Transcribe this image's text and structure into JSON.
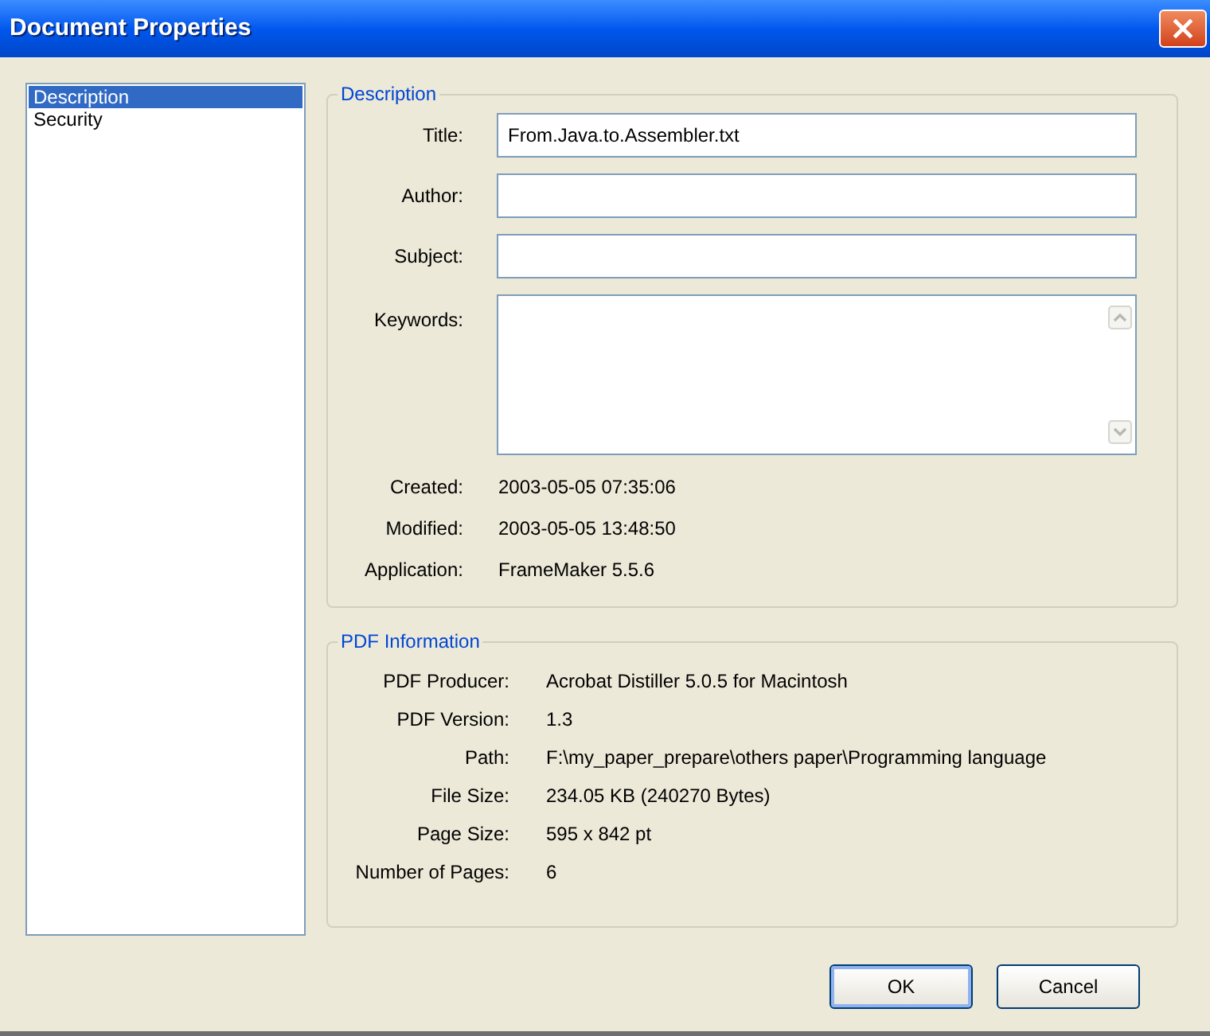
{
  "window": {
    "title": "Document Properties"
  },
  "sidebar": {
    "items": [
      {
        "label": "Description",
        "selected": true
      },
      {
        "label": "Security",
        "selected": false
      }
    ]
  },
  "description": {
    "heading": "Description",
    "fields": [
      {
        "label": "Title:",
        "kind": "text",
        "value": "From.Java.to.Assembler.txt"
      },
      {
        "label": "Author:",
        "kind": "text"
      },
      {
        "label": "Subject:",
        "kind": "text"
      },
      {
        "label": "Keywords:",
        "kind": "multiline"
      }
    ],
    "details": [
      {
        "label": "Created:",
        "value": "2003-05-05 07:35:06"
      },
      {
        "label": "Modified:",
        "value": "2003-05-05 13:48:50"
      },
      {
        "label": "Application:",
        "value": "FrameMaker 5.5.6"
      }
    ]
  },
  "pdf_information": {
    "heading": "PDF Information",
    "rows": [
      {
        "label": "PDF Producer:",
        "value": "Acrobat Distiller 5.0.5 for Macintosh"
      },
      {
        "label": "PDF Version:",
        "value": "1.3"
      },
      {
        "label": "Path:",
        "value": "F:\\my_paper_prepare\\others paper\\Programming language"
      },
      {
        "label": "File Size:",
        "value": "234.05 KB (240270 Bytes)"
      },
      {
        "label": "Page Size:",
        "value": "595 x 842 pt"
      },
      {
        "label": "Number of Pages:",
        "value": "6"
      }
    ]
  },
  "buttons": [
    {
      "label": "OK",
      "default": true
    },
    {
      "label": "Cancel",
      "default": false
    }
  ]
}
